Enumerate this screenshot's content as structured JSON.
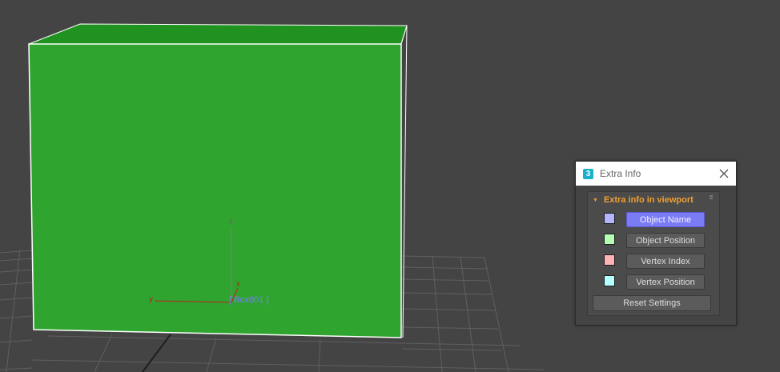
{
  "viewport": {
    "object_label": "[ Box001 ]",
    "gizmo": {
      "z_label": "z",
      "x_label": "x",
      "y_label": "y"
    },
    "colors": {
      "background": "#444444",
      "box": "#2fa52f",
      "box_top": "#209220",
      "grid": "#5f5f5f"
    }
  },
  "dialog": {
    "title": "Extra Info",
    "app_icon_text": "3",
    "rollout": {
      "title": "Extra info in viewport",
      "rows": [
        {
          "swatch_color": "#b4b4ff",
          "label": "Object Name",
          "active": true
        },
        {
          "swatch_color": "#b4ffb4",
          "label": "Object Position",
          "active": false
        },
        {
          "swatch_color": "#ffb4b4",
          "label": "Vertex Index",
          "active": false
        },
        {
          "swatch_color": "#b4ffff",
          "label": "Vertex Position",
          "active": false
        }
      ],
      "reset_label": "Reset Settings"
    }
  }
}
